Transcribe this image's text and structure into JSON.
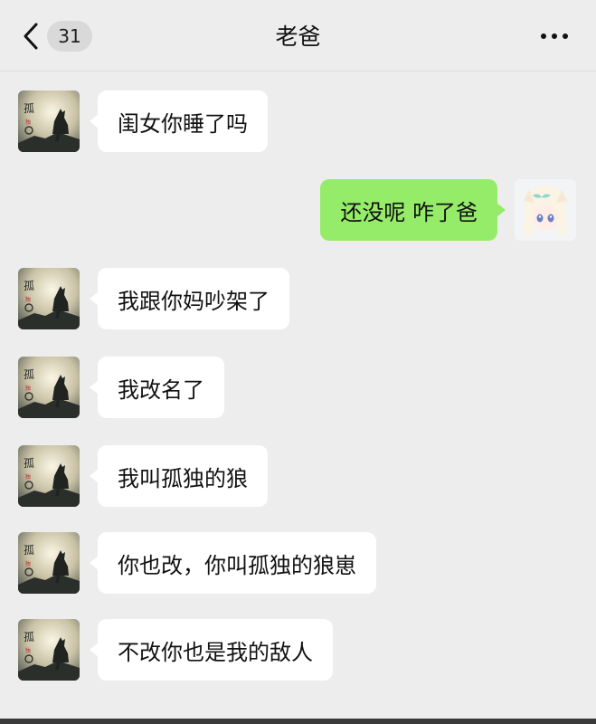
{
  "header": {
    "back_label": "back",
    "unread_count": "31",
    "title": "老爸",
    "more_label": "more options"
  },
  "colors": {
    "background": "#ededed",
    "bubble_incoming": "#ffffff",
    "bubble_outgoing": "#95ec69"
  },
  "messages": [
    {
      "sender": "dad",
      "text": "闺女你睡了吗",
      "avatar_icon": "wolf-avatar-icon"
    },
    {
      "sender": "me",
      "text": "还没呢 咋了爸",
      "avatar_icon": "anime-girl-avatar-icon"
    },
    {
      "sender": "dad",
      "text": "我跟你妈吵架了",
      "avatar_icon": "wolf-avatar-icon"
    },
    {
      "sender": "dad",
      "text": "我改名了",
      "avatar_icon": "wolf-avatar-icon"
    },
    {
      "sender": "dad",
      "text": "我叫孤独的狼",
      "avatar_icon": "wolf-avatar-icon"
    },
    {
      "sender": "dad",
      "text": "你也改，你叫孤独的狼崽",
      "avatar_icon": "wolf-avatar-icon"
    },
    {
      "sender": "dad",
      "text": "不改你也是我的敌人",
      "avatar_icon": "wolf-avatar-icon"
    }
  ]
}
